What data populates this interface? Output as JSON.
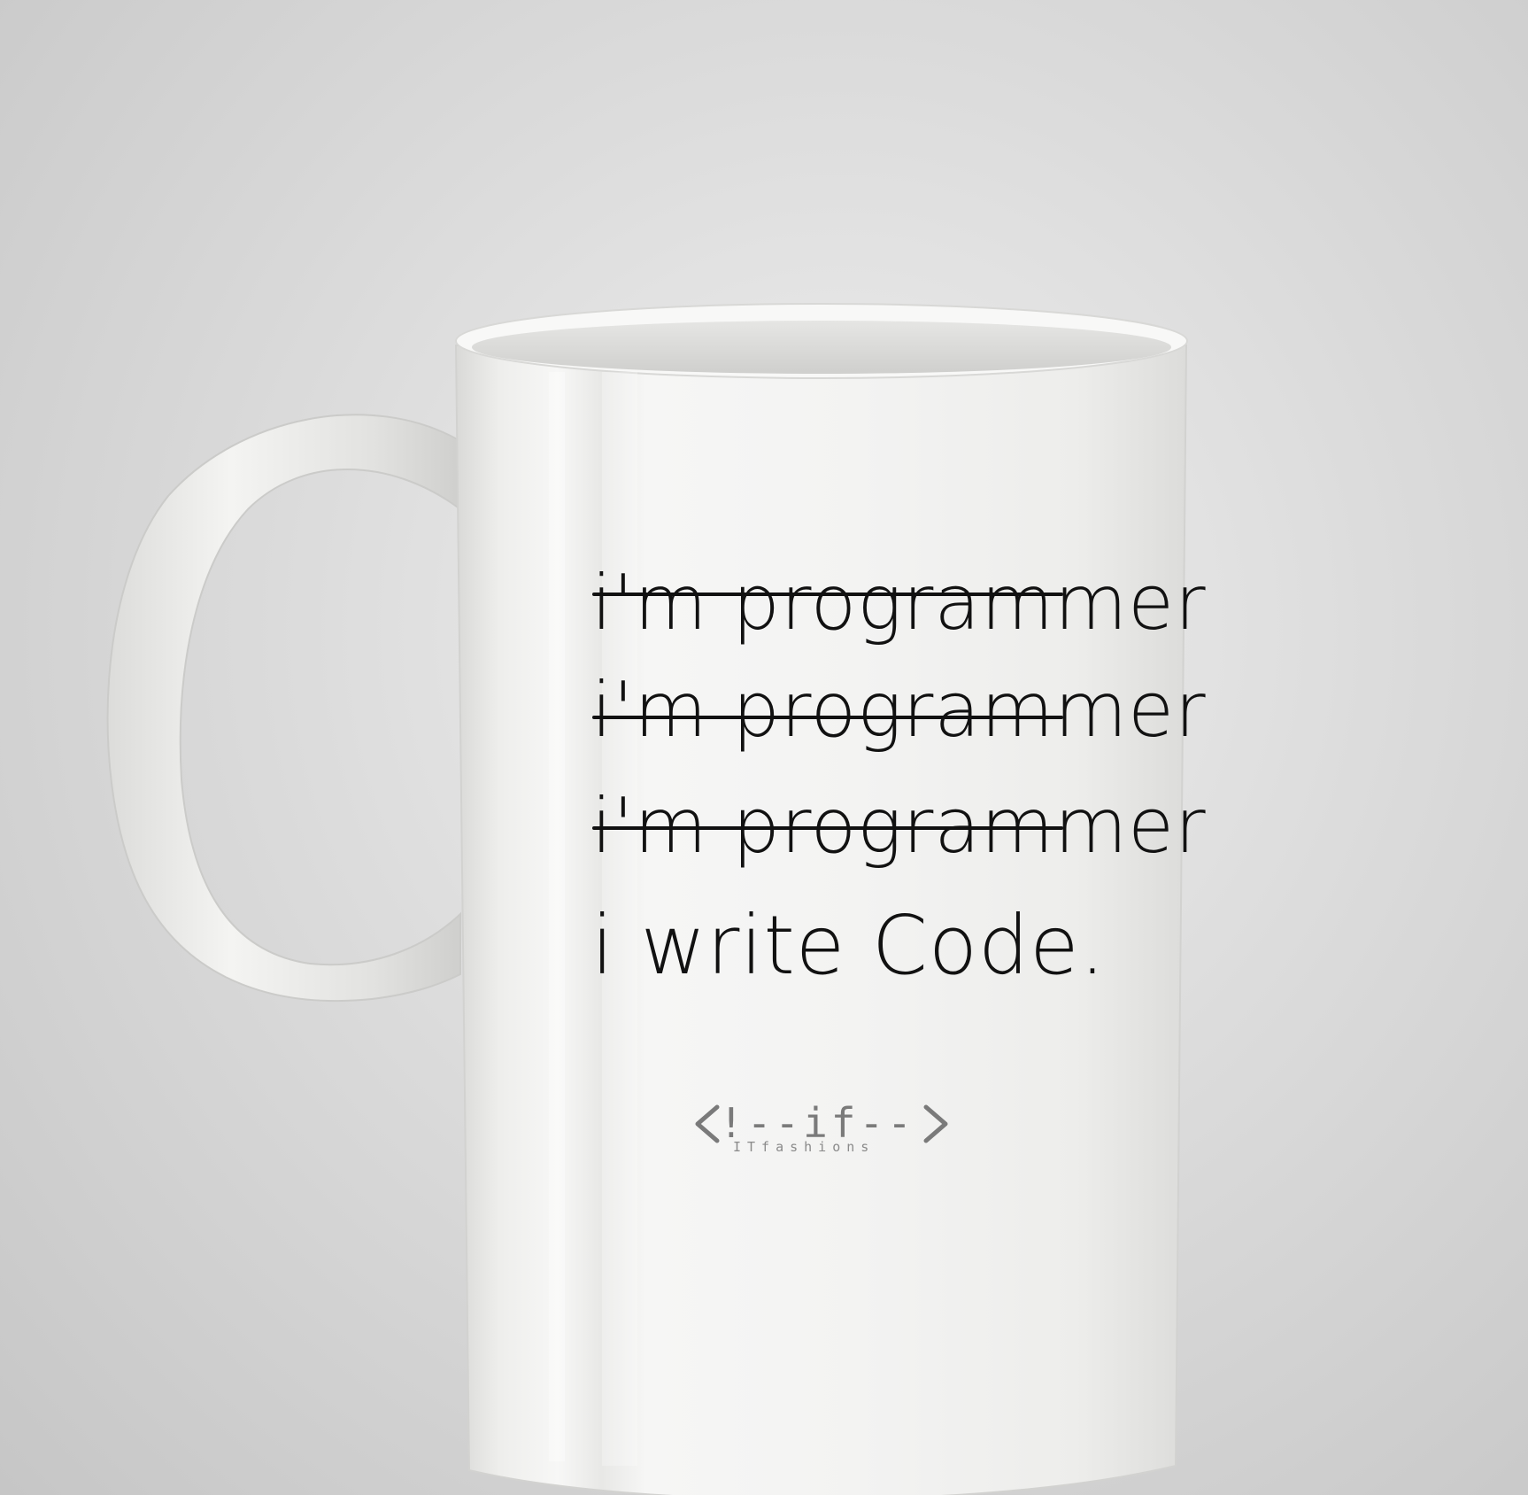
{
  "photo": {
    "subject": "white ceramic mug",
    "background_color": "#cfcfcf",
    "mug_color": "#f2f2f0",
    "ink_color": "#111111",
    "logo_color": "#7a7a7a"
  },
  "mug_print": {
    "struck_lines": [
      "i'm programmer",
      "i'm programmer",
      "i'm programmer"
    ],
    "final_line": "i write Code."
  },
  "logo": {
    "mark": "!--if--",
    "tagline": "ITfashions",
    "left_bracket_icon": "angle-left-icon",
    "right_bracket_icon": "angle-right-icon"
  }
}
